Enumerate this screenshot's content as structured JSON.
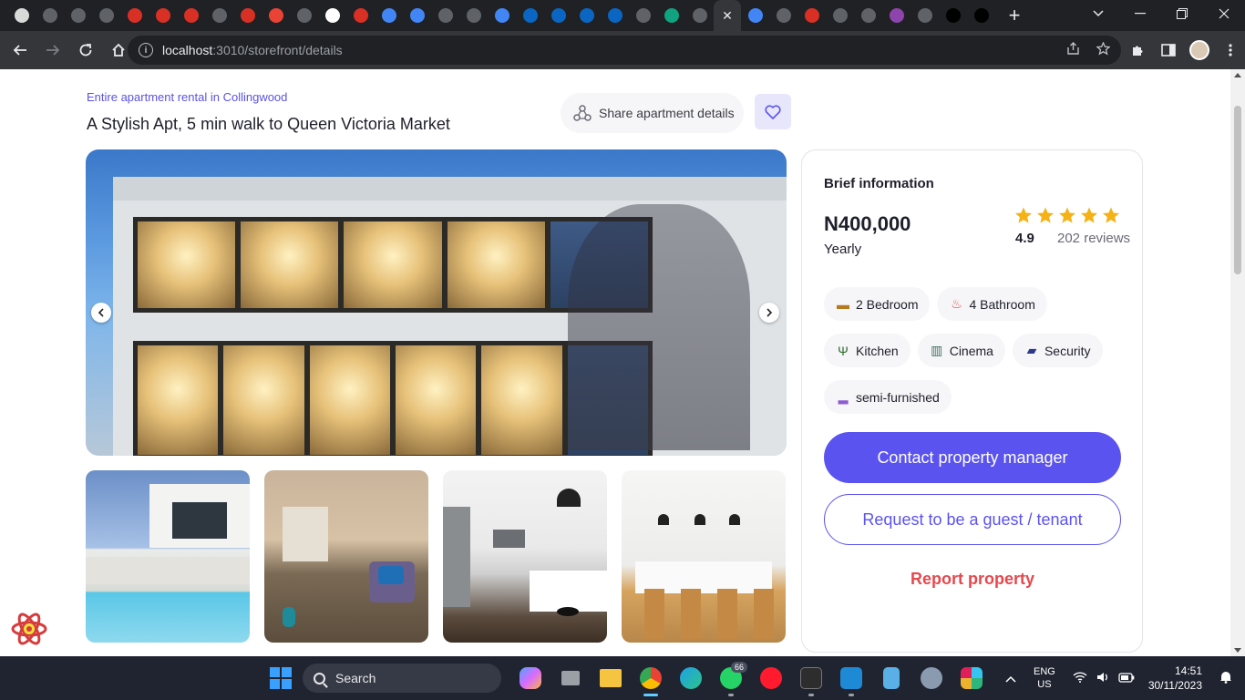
{
  "browser": {
    "tab_favicons": [
      {
        "icon": "rabbit-icon",
        "color": "#d9d9d9"
      },
      {
        "icon": "x-icon",
        "color": "#5f6368"
      },
      {
        "icon": "github-icon",
        "color": "#5f6368"
      },
      {
        "icon": "react-icon",
        "color": "#5f6368"
      },
      {
        "icon": "chrome-ext-icon",
        "color": "#d93025"
      },
      {
        "icon": "chrome-ext-icon",
        "color": "#d93025"
      },
      {
        "icon": "chrome-ext-icon",
        "color": "#d93025"
      },
      {
        "icon": "globe-icon",
        "color": "#5f6368"
      },
      {
        "icon": "chrome-ext-icon",
        "color": "#d93025"
      },
      {
        "icon": "gmail-icon",
        "color": "#ea4335"
      },
      {
        "icon": "github-icon",
        "color": "#5f6368"
      },
      {
        "icon": "github-icon",
        "color": "#ffffff"
      },
      {
        "icon": "chrome-ext-icon",
        "color": "#d93025"
      },
      {
        "icon": "docs-icon",
        "color": "#4285f4"
      },
      {
        "icon": "calendar-icon",
        "color": "#4285f4"
      },
      {
        "icon": "globe-icon",
        "color": "#5f6368"
      },
      {
        "icon": "github-icon",
        "color": "#5f6368"
      },
      {
        "icon": "chrome-ext-icon",
        "color": "#4285f4"
      },
      {
        "icon": "linkedin-icon",
        "color": "#0a66c2"
      },
      {
        "icon": "linkedin-icon",
        "color": "#0a66c2"
      },
      {
        "icon": "play-icon",
        "color": "#0a66c2"
      },
      {
        "icon": "linkedin-icon",
        "color": "#0a66c2"
      },
      {
        "icon": "a-icon",
        "color": "#5f6368"
      },
      {
        "icon": "diamond-icon",
        "color": "#10a37f"
      },
      {
        "icon": "chrome-ext-icon",
        "color": "#5f6368"
      }
    ],
    "tab_favicons_right": [
      {
        "icon": "diamond-icon",
        "color": "#4285f4"
      },
      {
        "icon": "github-icon",
        "color": "#5f6368"
      },
      {
        "icon": "chrome-ext-icon",
        "color": "#d93025"
      },
      {
        "icon": "linkedin-icon",
        "color": "#5f6368"
      },
      {
        "icon": "docs-icon",
        "color": "#5f6368"
      },
      {
        "icon": "chrome-ext-icon",
        "color": "#8e44ad"
      },
      {
        "icon": "github-icon",
        "color": "#5f6368"
      },
      {
        "icon": "triangle-icon",
        "color": "#000000"
      },
      {
        "icon": "x-icon",
        "color": "#000000"
      }
    ],
    "active_tab_glyph": "✕",
    "newtab_glyph": "+",
    "url_host": "localhost",
    "url_rest": ":3010/storefront/details"
  },
  "listing": {
    "subtitle": "Entire apartment rental in Collingwood",
    "title": "A Stylish Apt, 5 min walk to Queen Victoria Market",
    "share_label": "Share apartment details"
  },
  "card": {
    "brief_title": "Brief information",
    "price": "N400,000",
    "period": "Yearly",
    "stars": 5,
    "rating": "4.9",
    "reviews": "202 reviews",
    "amenities": [
      {
        "label": "2 Bedroom",
        "icon": "bed-icon",
        "glyph": "▬",
        "color": "#b7791f"
      },
      {
        "label": "4 Bathroom",
        "icon": "shower-icon",
        "glyph": "♨",
        "color": "#e5484d"
      },
      {
        "label": "Kitchen",
        "icon": "utensils-icon",
        "glyph": "Ψ",
        "color": "#2f6b2f"
      },
      {
        "label": "Cinema",
        "icon": "popcorn-icon",
        "glyph": "▥",
        "color": "#3c6e5a"
      },
      {
        "label": "Security",
        "icon": "cctv-icon",
        "glyph": "▰",
        "color": "#2b3a8c"
      },
      {
        "label": "semi-furnished",
        "icon": "sofa-icon",
        "glyph": "▂",
        "color": "#8e5bd0"
      }
    ],
    "contact_label": "Contact property manager",
    "request_label": "Request to be a guest / tenant",
    "report_label": "Report property"
  },
  "taskbar": {
    "search_label": "Search",
    "whatsapp_badge": "66",
    "lang_line1": "ENG",
    "lang_line2": "US",
    "time": "14:51",
    "date": "30/11/2023"
  },
  "colors": {
    "accent": "#5b53f0",
    "danger": "#e5484d",
    "star": "#f5b217"
  }
}
